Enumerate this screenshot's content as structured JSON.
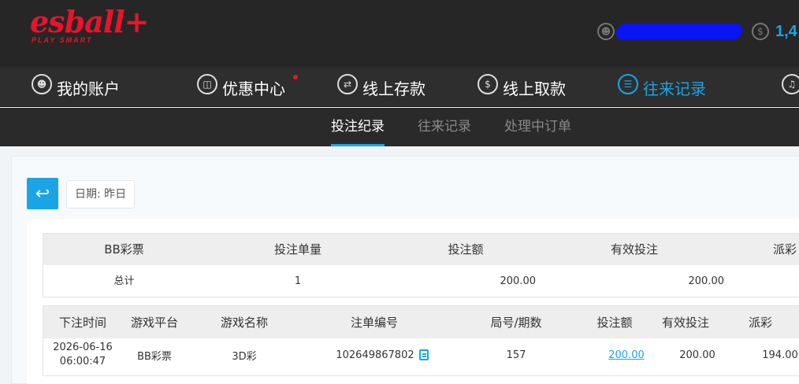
{
  "brand": {
    "logo_text": "esball+",
    "tagline": "PLAY SMART"
  },
  "user": {
    "balance": "1,4"
  },
  "main_nav": [
    {
      "label": "我的账户",
      "icon": "user-icon"
    },
    {
      "label": "优惠中心",
      "icon": "gift-icon",
      "badge": true
    },
    {
      "label": "线上存款",
      "icon": "deposit-icon"
    },
    {
      "label": "线上取款",
      "icon": "withdraw-icon"
    },
    {
      "label": "往来记录",
      "icon": "record-icon",
      "active": true
    },
    {
      "label": "",
      "icon": "bell-icon"
    }
  ],
  "sub_tabs": [
    {
      "label": "投注纪录",
      "active": true
    },
    {
      "label": "往来记录"
    },
    {
      "label": "处理中订单"
    }
  ],
  "filter": {
    "date_label": "日期: 昨日"
  },
  "summary": {
    "headers": [
      "BB彩票",
      "投注单量",
      "投注额",
      "有效投注",
      "派彩"
    ],
    "row": [
      "总计",
      "1",
      "200.00",
      "200.00",
      ""
    ]
  },
  "details": {
    "headers": [
      "下注时间",
      "游戏平台",
      "游戏名称",
      "注单编号",
      "局号/期数",
      "投注额",
      "有效投注",
      "派彩"
    ],
    "rows": [
      {
        "date": "2026-06-16",
        "time": "06:00:47",
        "platform": "BB彩票",
        "game": "3D彩",
        "order_no": "102649867802",
        "round": "157",
        "bet": "200.00",
        "valid": "200.00",
        "payout": "194.00"
      }
    ]
  },
  "colors": {
    "accent": "#1aa4e6",
    "brand_red": "#e8142c",
    "header_bg": "#262626"
  }
}
